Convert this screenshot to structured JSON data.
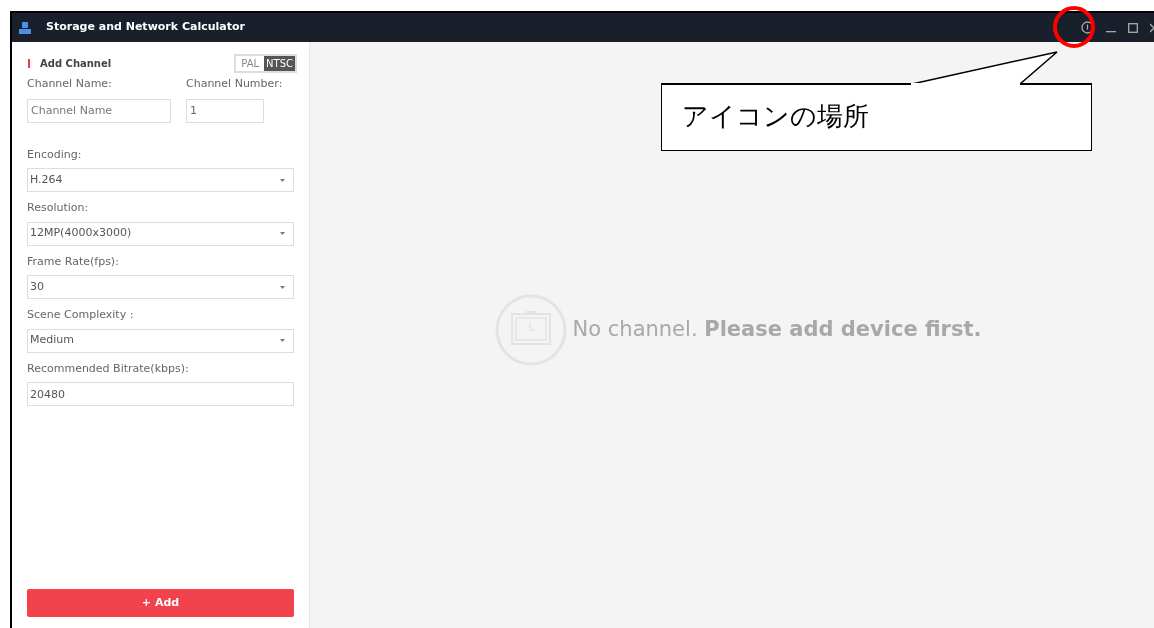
{
  "window": {
    "title": "Storage and Network Calculator"
  },
  "sidebar": {
    "heading": "Add Channel",
    "video_standard": [
      {
        "label": "PAL",
        "selected": false
      },
      {
        "label": "NTSC",
        "selected": true
      }
    ],
    "channel_name": {
      "label": "Channel Name:",
      "placeholder": "Channel Name"
    },
    "channel_number": {
      "label": "Channel Number:",
      "value": "1"
    },
    "fields": [
      {
        "kind": "select",
        "label": "Encoding:",
        "value": "H.264"
      },
      {
        "kind": "select",
        "label": "Resolution:",
        "value": "12MP(4000x3000)"
      },
      {
        "kind": "select",
        "label": "Frame Rate(fps):",
        "value": "30"
      },
      {
        "kind": "select",
        "label": "Scene Complexity :",
        "value": "Medium"
      },
      {
        "kind": "input",
        "label": "Recommended Bitrate(kbps):",
        "value": "20480"
      }
    ],
    "add_button": "+ Add"
  },
  "empty_state": {
    "message": "No channel. **Please add device first.**"
  },
  "annotation": {
    "text": "アイコンの場所"
  }
}
